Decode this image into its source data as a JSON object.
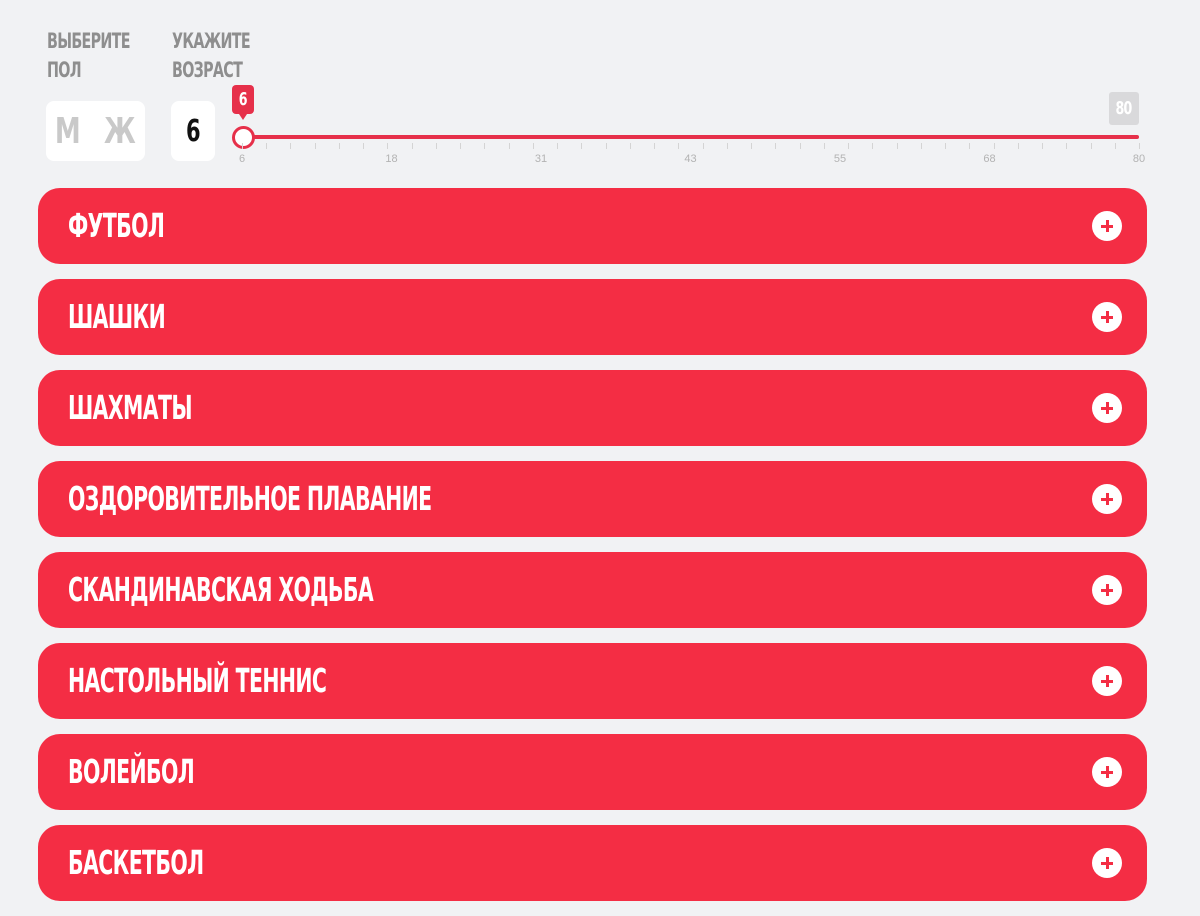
{
  "filters": {
    "gender_label": [
      "Выберите",
      "пол"
    ],
    "gender_options": [
      "М",
      "Ж"
    ],
    "age_label": [
      "Укажите",
      "возраст"
    ],
    "age_value": "6"
  },
  "slider": {
    "min": 6,
    "max": 80,
    "value": 6,
    "value_label": "6",
    "max_label": "80",
    "tick_labels": [
      "6",
      "18",
      "31",
      "43",
      "55",
      "68",
      "80"
    ],
    "accent_color": "#e6304a"
  },
  "activities": [
    {
      "title": "Футбол",
      "icon": "plus-icon"
    },
    {
      "title": "Шашки",
      "icon": "plus-icon"
    },
    {
      "title": "Шахматы",
      "icon": "plus-icon"
    },
    {
      "title": "Оздоровительное плавание",
      "icon": "plus-icon"
    },
    {
      "title": "Скандинавская ходьба",
      "icon": "plus-icon"
    },
    {
      "title": "Настольный теннис",
      "icon": "plus-icon"
    },
    {
      "title": "Волейбол",
      "icon": "plus-icon"
    },
    {
      "title": "Баскетбол",
      "icon": "plus-icon"
    }
  ],
  "colors": {
    "accordion_bg": "#f42d44",
    "page_bg": "#f1f2f4",
    "label_gray": "#8e8e8e"
  }
}
